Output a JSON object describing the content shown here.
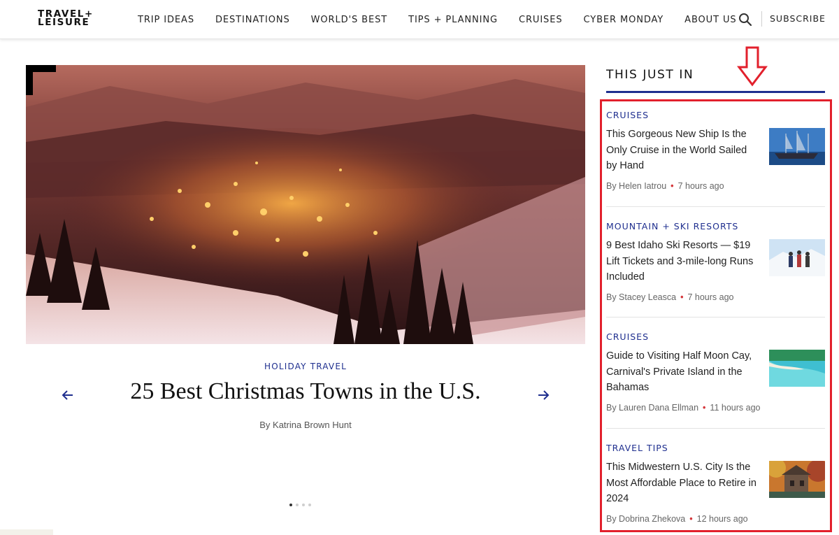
{
  "header": {
    "logo_line1": "TRAVEL+",
    "logo_line2": "LEISURE",
    "nav": [
      "TRIP IDEAS",
      "DESTINATIONS",
      "WORLD'S BEST",
      "TIPS + PLANNING",
      "CRUISES",
      "CYBER MONDAY",
      "ABOUT US"
    ],
    "search_icon": "search-icon",
    "subscribe_label": "SUBSCRIBE"
  },
  "hero": {
    "category": "HOLIDAY TRAVEL",
    "title": "25 Best Christmas Towns in the U.S.",
    "byline": "By Katrina Brown Hunt",
    "prev_icon": "arrow-left-icon",
    "next_icon": "arrow-right-icon",
    "slide_count": 4,
    "active_slide": 1
  },
  "sidebar": {
    "heading": "THIS JUST IN",
    "annotation_icon": "down-arrow-icon",
    "articles": [
      {
        "category": "CRUISES",
        "title": "This Gorgeous New Ship Is the Only Cruise in the World Sailed by Hand",
        "author": "By Helen Iatrou",
        "time": "7 hours ago"
      },
      {
        "category": "MOUNTAIN + SKI RESORTS",
        "title": "9 Best Idaho Ski Resorts — $19 Lift Tickets and 3-mile-long Runs Included",
        "author": "By Stacey Leasca",
        "time": "7 hours ago"
      },
      {
        "category": "CRUISES",
        "title": "Guide to Visiting Half Moon Cay, Carnival's Private Island in the Bahamas",
        "author": "By Lauren Dana Ellman",
        "time": "11 hours ago"
      },
      {
        "category": "TRAVEL TIPS",
        "title": "This Midwestern U.S. City Is the Most Affordable Place to Retire in 2024",
        "author": "By Dobrina Zhekova",
        "time": "12 hours ago"
      }
    ]
  },
  "colors": {
    "accent_blue": "#1f2f8f",
    "highlight_red": "#e2202c",
    "meta_dot": "#d4363a"
  }
}
